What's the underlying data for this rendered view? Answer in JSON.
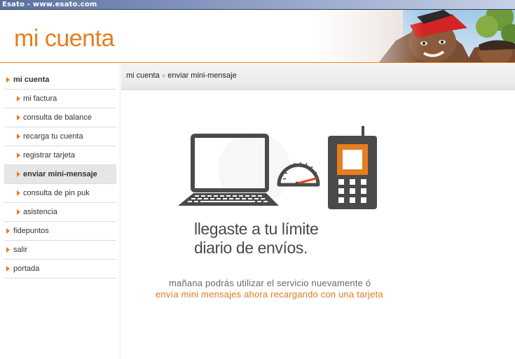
{
  "window": {
    "title": "Esato - www.esato.com"
  },
  "header": {
    "title": "mi cuenta"
  },
  "sidebar": {
    "items": [
      {
        "label": "mi cuenta",
        "level": "top",
        "bold": true,
        "active": false
      },
      {
        "label": "mi factura",
        "level": "sub",
        "bold": false,
        "active": false
      },
      {
        "label": "consulta de balance",
        "level": "sub",
        "bold": false,
        "active": false
      },
      {
        "label": "recarga tu cuenta",
        "level": "sub",
        "bold": false,
        "active": false
      },
      {
        "label": "registrar tarjeta",
        "level": "sub",
        "bold": false,
        "active": false
      },
      {
        "label": "enviar mini-mensaje",
        "level": "sub",
        "bold": true,
        "active": true
      },
      {
        "label": "consulta de pin puk",
        "level": "sub",
        "bold": false,
        "active": false
      },
      {
        "label": "asistencia",
        "level": "sub",
        "bold": false,
        "active": false
      },
      {
        "label": "fidepuntos",
        "level": "top",
        "bold": false,
        "active": false
      },
      {
        "label": "salir",
        "level": "top",
        "bold": false,
        "active": false
      },
      {
        "label": "portada",
        "level": "top",
        "bold": false,
        "active": false
      }
    ]
  },
  "breadcrumb": {
    "items": [
      "mi cuenta",
      "enviar mini-mensaje"
    ],
    "separator": "»"
  },
  "main": {
    "limit_line_1": "llegaste a tu límite",
    "limit_line_2": "diario de envíos.",
    "info_line": "mañana podrás utilizar el servicio nuevamente ó",
    "recharge_link": "envía mini mensajes ahora recargando con una tarjeta"
  },
  "icons": [
    "laptop-icon",
    "speedometer-icon",
    "mobile-phone-icon",
    "nav-arrow-icon"
  ],
  "colors": {
    "brand_orange": "#e77d1e",
    "active_item_bg": "#e6e6e6",
    "illustration_gray": "#4a4a4a",
    "link_orange": "#e07a1b"
  }
}
